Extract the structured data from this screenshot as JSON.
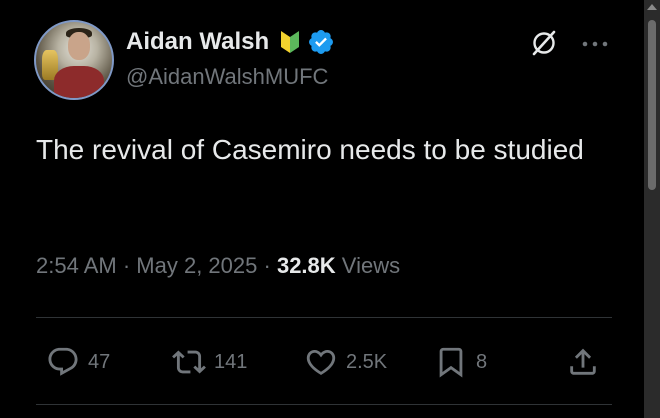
{
  "author": {
    "display_name": "Aidan Walsh",
    "handle": "@AidanWalshMUFC"
  },
  "icons": {
    "beginner_badge": "beginner-mark-icon",
    "verified_badge": "verified-badge-icon",
    "grok": "grok-icon",
    "more": "more-options-icon",
    "reply": "reply-icon",
    "retweet": "retweet-icon",
    "like": "heart-icon",
    "bookmark": "bookmark-icon",
    "share": "share-icon"
  },
  "tweet": {
    "text": "The revival of Casemiro needs to be studied"
  },
  "meta": {
    "time": "2:54 AM",
    "date": "May 2, 2025",
    "separator": "·",
    "views_count": "32.8K",
    "views_label": "Views"
  },
  "actions": {
    "replies": "47",
    "retweets": "141",
    "likes": "2.5K",
    "bookmarks": "8"
  },
  "colors": {
    "background": "#000000",
    "text_primary": "#e7e9ea",
    "text_secondary": "#71767b",
    "verified_blue": "#1d9bf0",
    "divider": "#2f3336"
  }
}
